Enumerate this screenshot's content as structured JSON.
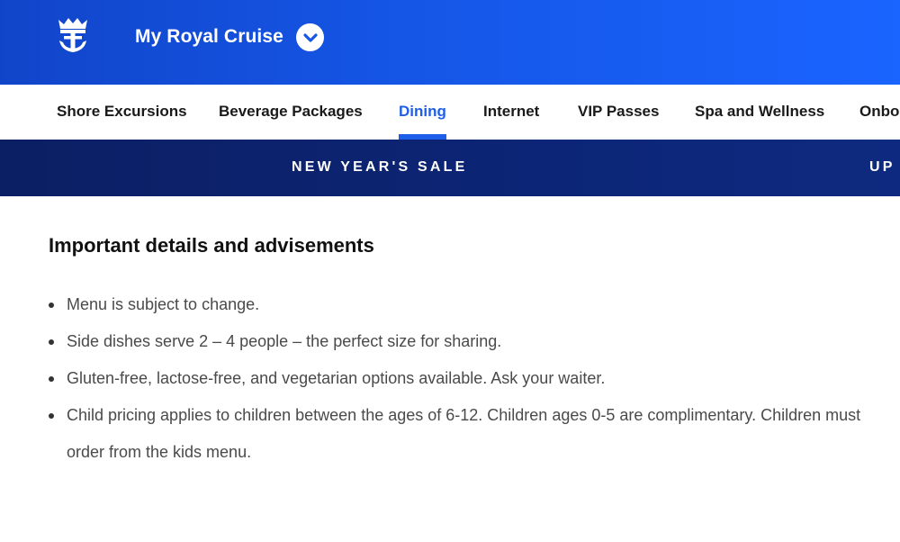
{
  "header": {
    "logo_icon": "crown-anchor-logo-icon",
    "title": "My Royal Cruise",
    "dropdown_icon": "chevron-down-icon",
    "background_color": "#1556e6"
  },
  "nav": {
    "items": [
      {
        "label": "Shore Excursions",
        "active": false
      },
      {
        "label": "Beverage Packages",
        "active": false
      },
      {
        "label": "Dining",
        "active": true
      },
      {
        "label": "Internet",
        "active": false
      },
      {
        "label": "VIP Passes",
        "active": false
      },
      {
        "label": "Spa and Wellness",
        "active": false
      },
      {
        "label": "Onbo",
        "active": false
      }
    ],
    "active_color": "#1f5ee8"
  },
  "promo": {
    "primary": "NEW YEAR'S SALE",
    "secondary": "UP",
    "background_color": "#0c2576"
  },
  "content": {
    "heading": "Important details and advisements",
    "advisements": [
      "Menu is subject to change.",
      "Side dishes serve 2 – 4 people – the perfect size for sharing.",
      "Gluten-free, lactose-free, and vegetarian options available. Ask your waiter.",
      "Child pricing applies to children between the ages of 6-12. Children ages 0-5 are complimentary. Children must order from the kids menu."
    ]
  }
}
